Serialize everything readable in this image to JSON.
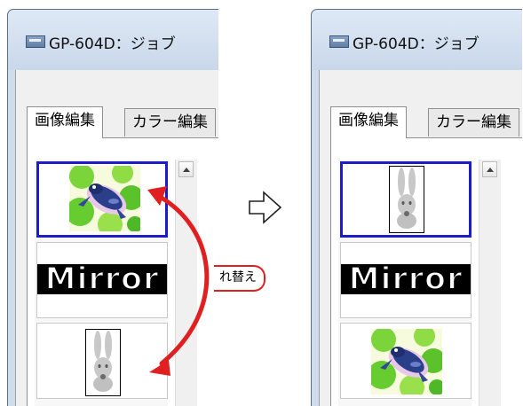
{
  "window": {
    "title": "GP-604D：ジョブ",
    "tabs": [
      "画像編集",
      "カラー編集"
    ]
  },
  "left_panel": {
    "items": [
      {
        "name": "frog-image",
        "selected": true
      },
      {
        "name": "mirror-text-image",
        "text": "Mirror",
        "selected": false
      },
      {
        "name": "rabbit-image",
        "selected": false
      }
    ]
  },
  "right_panel": {
    "items": [
      {
        "name": "rabbit-image",
        "selected": true
      },
      {
        "name": "mirror-text-image",
        "text": "Mirror",
        "selected": false
      },
      {
        "name": "frog-image",
        "selected": false
      }
    ]
  },
  "annotation": {
    "swap_label": "れ替え"
  },
  "colors": {
    "selection": "#1c1cc9",
    "swap_arrow": "#e02020"
  },
  "icons": [
    "app-icon",
    "scroll-up-icon",
    "hollow-right-arrow-icon",
    "double-headed-curved-arrow-icon"
  ]
}
